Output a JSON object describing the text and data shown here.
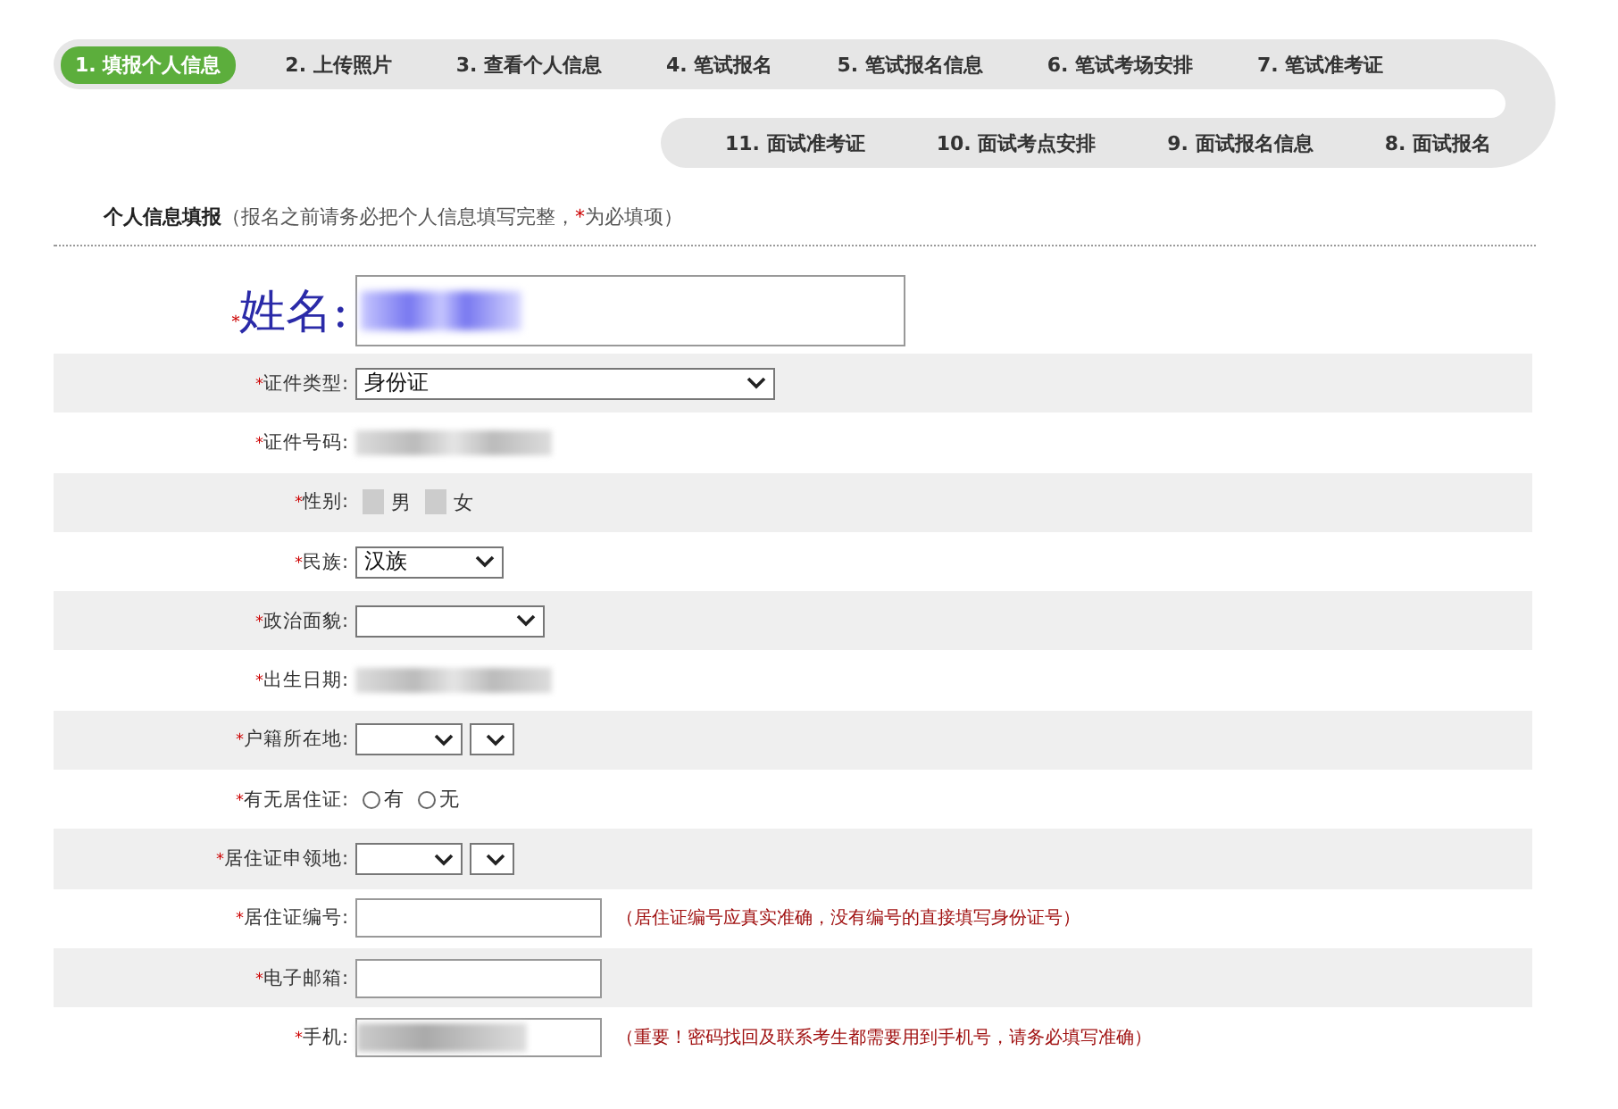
{
  "steps_row_1": [
    {
      "label": "1. 填报个人信息",
      "selected": true
    },
    {
      "label": "2. 上传照片",
      "selected": false
    },
    {
      "label": "3. 查看个人信息",
      "selected": false
    },
    {
      "label": "4. 笔试报名",
      "selected": false
    },
    {
      "label": "5. 笔试报名信息",
      "selected": false
    },
    {
      "label": "6. 笔试考场安排",
      "selected": false
    },
    {
      "label": "7. 笔试准考证",
      "selected": false
    }
  ],
  "steps_row_2": [
    {
      "label": "11. 面试准考证",
      "selected": false
    },
    {
      "label": "10. 面试考点安排",
      "selected": false
    },
    {
      "label": "9. 面试报名信息",
      "selected": false
    },
    {
      "label": "8. 面试报名",
      "selected": false
    }
  ],
  "section": {
    "title": "个人信息填报",
    "note_open": "（报名之前请务必把个人信息填写完整，",
    "required_mark": "*",
    "note_close": "为必填项）"
  },
  "fields": [
    {
      "kind": "name",
      "label": "姓名:",
      "required": true
    },
    {
      "kind": "select",
      "label": "证件类型:",
      "required": true,
      "value": "身份证"
    },
    {
      "kind": "redacted",
      "label": "证件号码:",
      "required": true
    },
    {
      "kind": "redacted_choice",
      "label": "性别:",
      "required": true,
      "options": [
        "男",
        "女"
      ]
    },
    {
      "kind": "select",
      "label": "民族:",
      "required": true,
      "value": "汉族"
    },
    {
      "kind": "select",
      "label": "政治面貌:",
      "required": true
    },
    {
      "kind": "redacted",
      "label": "出生日期:",
      "required": true
    },
    {
      "kind": "double_select",
      "label": "户籍所在地:",
      "required": true
    },
    {
      "kind": "radio",
      "label": "有无居住证:",
      "required": true,
      "options": [
        {
          "label": "有",
          "selected": false
        },
        {
          "label": "无",
          "selected": false
        }
      ]
    },
    {
      "kind": "double_select",
      "label": "居住证申领地:",
      "required": true
    },
    {
      "kind": "input",
      "label": "居住证编号:",
      "required": true,
      "hint": "（居住证编号应真实准确，没有编号的直接填写身份证号）"
    },
    {
      "kind": "input",
      "label": "电子邮箱:",
      "required": true
    },
    {
      "kind": "redacted_input",
      "label": "手机:",
      "required": true,
      "hint": "（重要！密码找回及联系考生都需要用到手机号，请务必填写准确）"
    }
  ]
}
